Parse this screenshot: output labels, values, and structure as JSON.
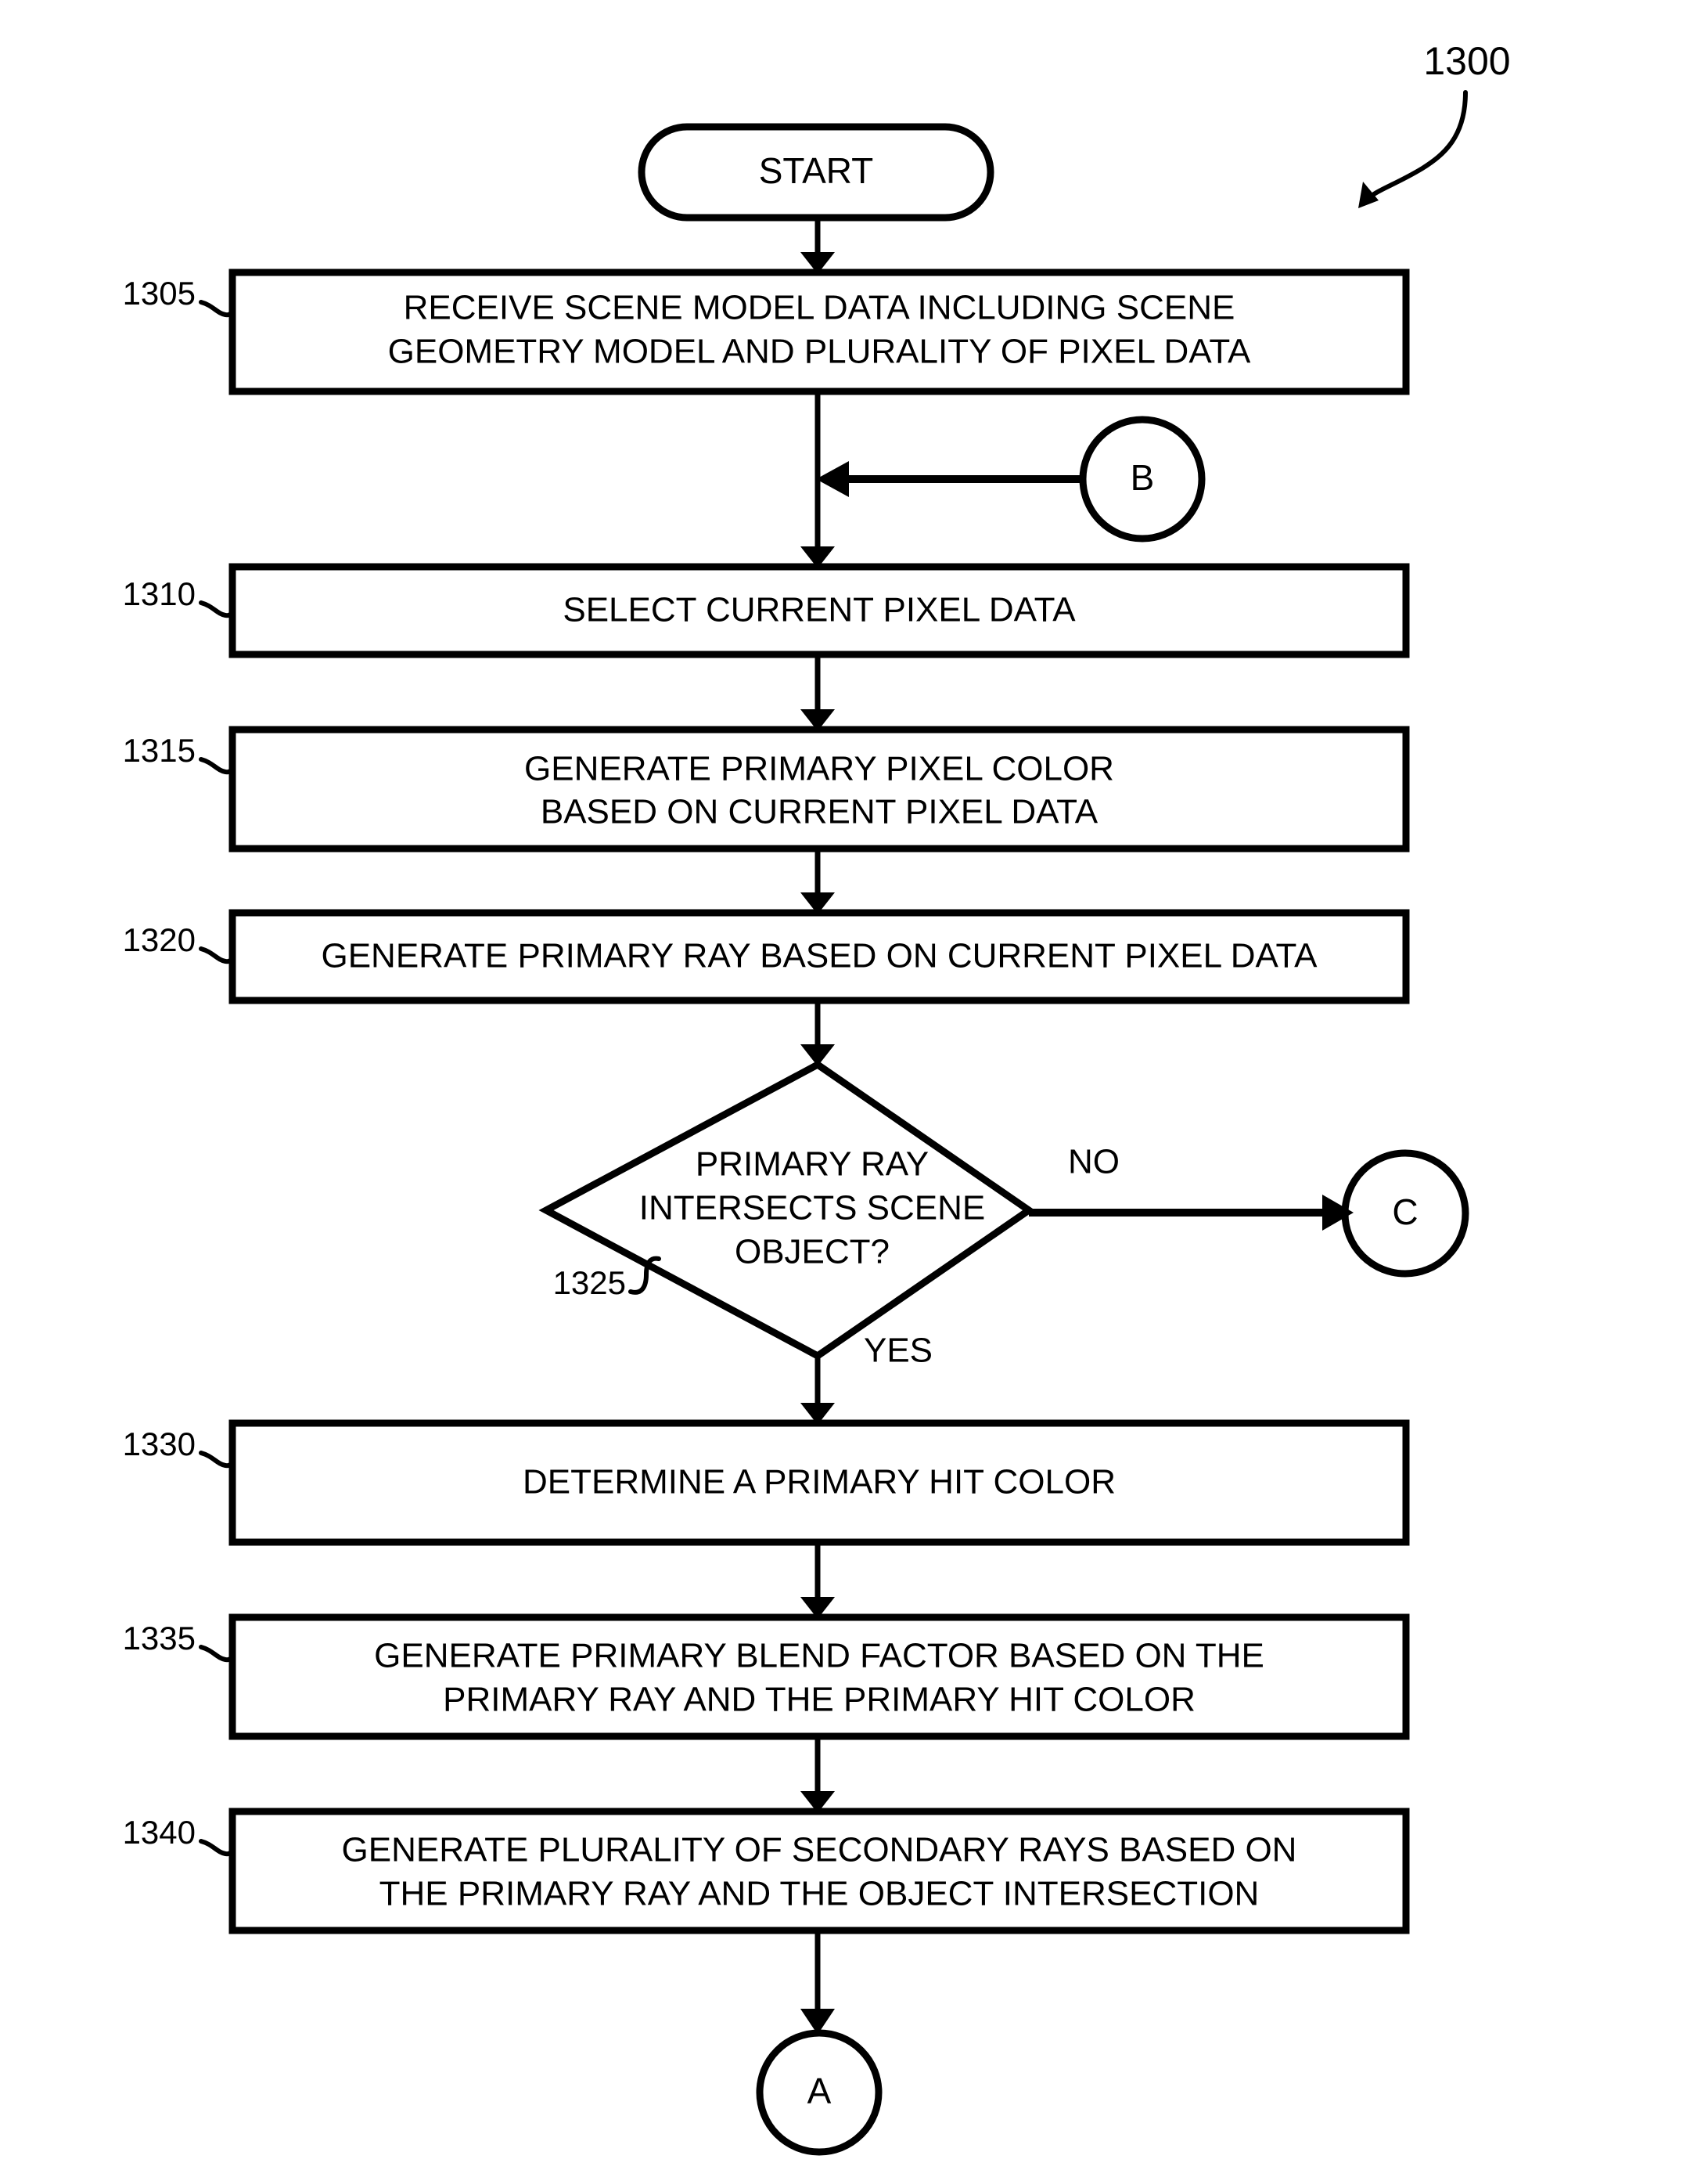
{
  "figure": {
    "number": "1300",
    "title_label": "1300"
  },
  "terminators": {
    "start": "START"
  },
  "connectors": [
    {
      "id": "B",
      "label": "B"
    },
    {
      "id": "C",
      "label": "C"
    },
    {
      "id": "A",
      "label": "A"
    }
  ],
  "steps": [
    {
      "ref": "1305",
      "lines": [
        "RECEIVE SCENE MODEL DATA INCLUDING SCENE",
        "GEOMETRY MODEL AND PLURALITY OF PIXEL DATA"
      ]
    },
    {
      "ref": "1310",
      "lines": [
        "SELECT CURRENT PIXEL DATA"
      ]
    },
    {
      "ref": "1315",
      "lines": [
        "GENERATE PRIMARY PIXEL COLOR",
        "BASED ON CURRENT PIXEL DATA"
      ]
    },
    {
      "ref": "1320",
      "lines": [
        "GENERATE PRIMARY RAY BASED ON CURRENT PIXEL DATA"
      ]
    },
    {
      "ref": "1330",
      "lines": [
        "DETERMINE A PRIMARY HIT COLOR"
      ]
    },
    {
      "ref": "1335",
      "lines": [
        "GENERATE PRIMARY BLEND FACTOR BASED ON THE",
        "PRIMARY RAY AND THE PRIMARY HIT COLOR"
      ]
    },
    {
      "ref": "1340",
      "lines": [
        "GENERATE PLURALITY OF SECONDARY RAYS BASED ON",
        "THE PRIMARY RAY AND THE OBJECT INTERSECTION"
      ]
    }
  ],
  "decision": {
    "ref": "1325",
    "lines": [
      "PRIMARY RAY",
      "INTERSECTS SCENE",
      "OBJECT?"
    ],
    "branch_no": "NO",
    "branch_yes": "YES"
  },
  "colors": {
    "stroke": "#000000",
    "fill": "#ffffff",
    "text": "#000000"
  }
}
